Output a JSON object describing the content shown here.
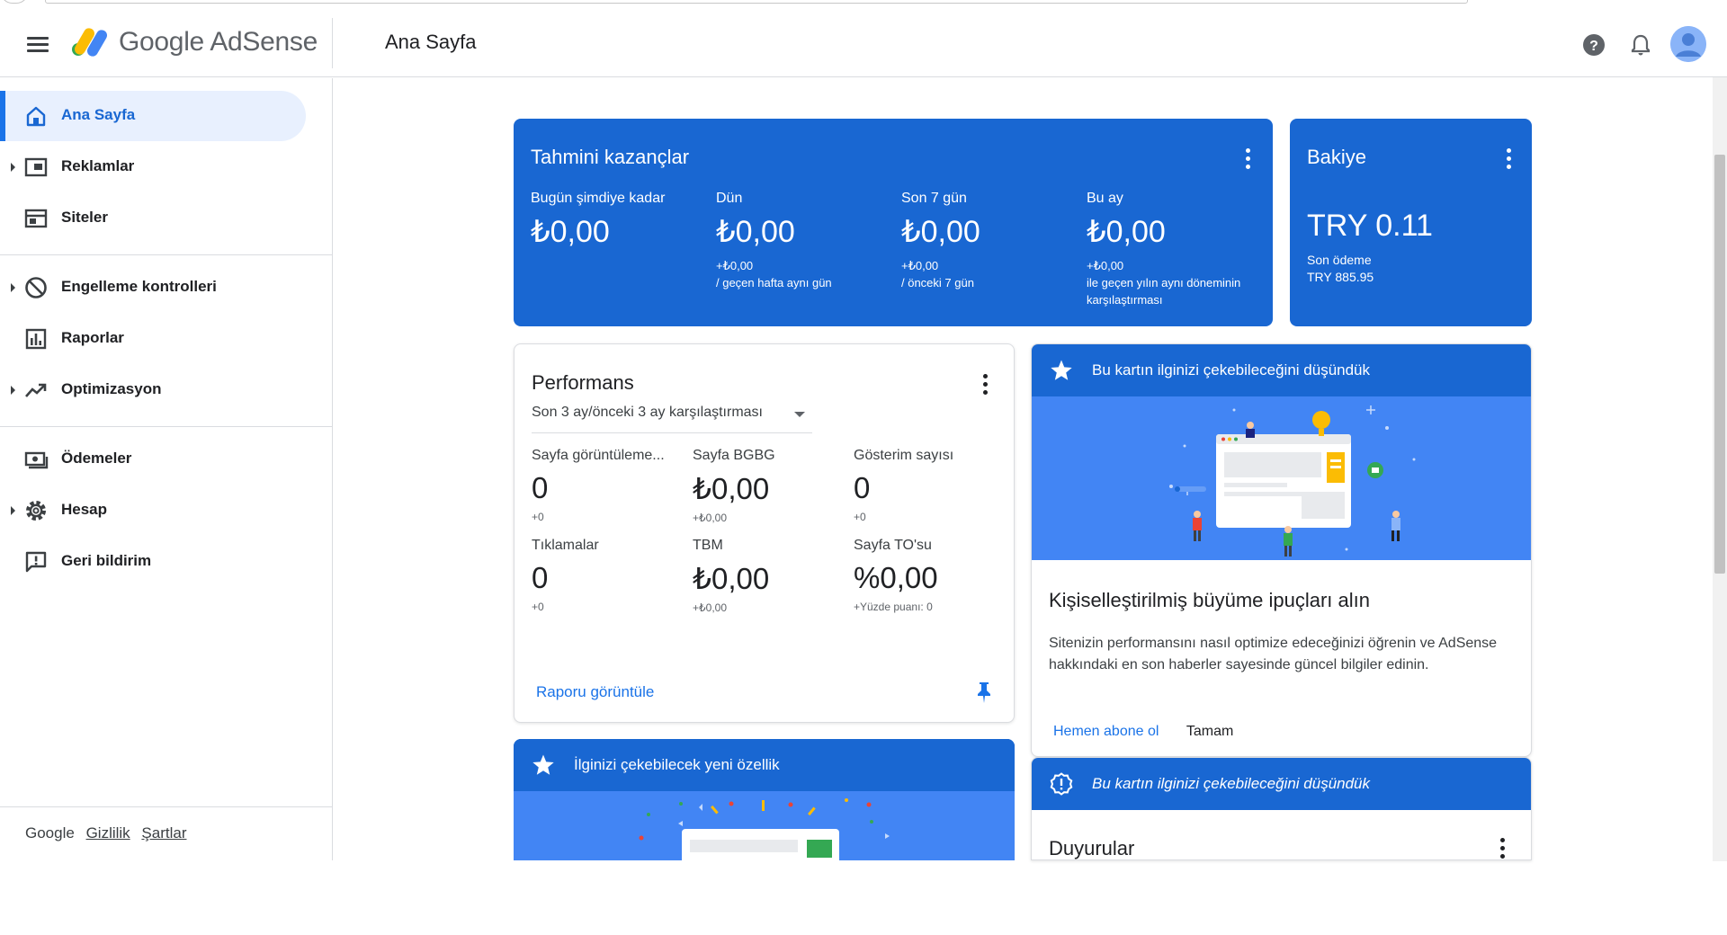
{
  "header": {
    "brand": "Google AdSense",
    "page_title": "Ana Sayfa"
  },
  "sidebar": {
    "items": [
      {
        "label": "Ana Sayfa",
        "icon": "home-icon",
        "active": true
      },
      {
        "label": "Reklamlar",
        "icon": "ads-icon"
      },
      {
        "label": "Siteler",
        "icon": "sites-icon"
      },
      {
        "label": "Engelleme kontrolleri",
        "icon": "block-icon"
      },
      {
        "label": "Raporlar",
        "icon": "reports-icon"
      },
      {
        "label": "Optimizasyon",
        "icon": "trending-up-icon"
      },
      {
        "label": "Ödemeler",
        "icon": "payments-icon"
      },
      {
        "label": "Hesap",
        "icon": "gear-icon"
      },
      {
        "label": "Geri bildirim",
        "icon": "feedback-icon"
      }
    ],
    "footer": {
      "google": "Google",
      "privacy": "Gizlilik",
      "terms": "Şartlar"
    }
  },
  "earnings": {
    "title": "Tahmini kazançlar",
    "cols": [
      {
        "label": "Bugün şimdiye kadar",
        "value": "₺0,00",
        "diff": "",
        "note": ""
      },
      {
        "label": "Dün",
        "value": "₺0,00",
        "diff": "+₺0,00",
        "note": "/ geçen hafta aynı gün"
      },
      {
        "label": "Son 7 gün",
        "value": "₺0,00",
        "diff": "+₺0,00",
        "note": "/ önceki 7 gün"
      },
      {
        "label": "Bu ay",
        "value": "₺0,00",
        "diff": "+₺0,00",
        "note": "ile geçen yılın aynı döneminin karşılaştırması"
      }
    ]
  },
  "balance": {
    "title": "Bakiye",
    "value": "TRY 0.11",
    "last_payment_label": "Son ödeme",
    "last_payment_value": "TRY 885.95"
  },
  "performance": {
    "title": "Performans",
    "period": "Son 3 ay/önceki 3 ay karşılaştırması",
    "metrics": [
      {
        "label": "Sayfa görüntüleme...",
        "value": "0",
        "diff": "+0"
      },
      {
        "label": "Sayfa BGBG",
        "value": "₺0,00",
        "diff": "+₺0,00"
      },
      {
        "label": "Gösterim sayısı",
        "value": "0",
        "diff": "+0"
      },
      {
        "label": "Tıklamalar",
        "value": "0",
        "diff": "+0"
      },
      {
        "label": "TBM",
        "value": "₺0,00",
        "diff": "+₺0,00"
      },
      {
        "label": "Sayfa TO'su",
        "value": "%0,00",
        "diff": "+Yüzde puanı: 0"
      }
    ],
    "view_report": "Raporu görüntüle"
  },
  "tips_card": {
    "header": "Bu kartın ilginizi çekebileceğini düşündük",
    "title": "Kişiselleştirilmiş büyüme ipuçları alın",
    "body": "Sitenizin performansını nasıl optimize edeceğinizi öğrenin ve AdSense hakkındaki en son haberler sayesinde güncel bilgiler edinin.",
    "subscribe": "Hemen abone ol",
    "ok": "Tamam"
  },
  "feature_card": {
    "header": "İlginizi çekebilecek yeni özellik"
  },
  "announcements_card": {
    "header": "Bu kartın ilginizi çekebileceğini düşündük",
    "title": "Duyurular"
  },
  "colors": {
    "accent": "#1967d2",
    "illustration": "#4285f4",
    "active_nav_bg": "#e8f0fe",
    "link": "#1a73e8"
  }
}
